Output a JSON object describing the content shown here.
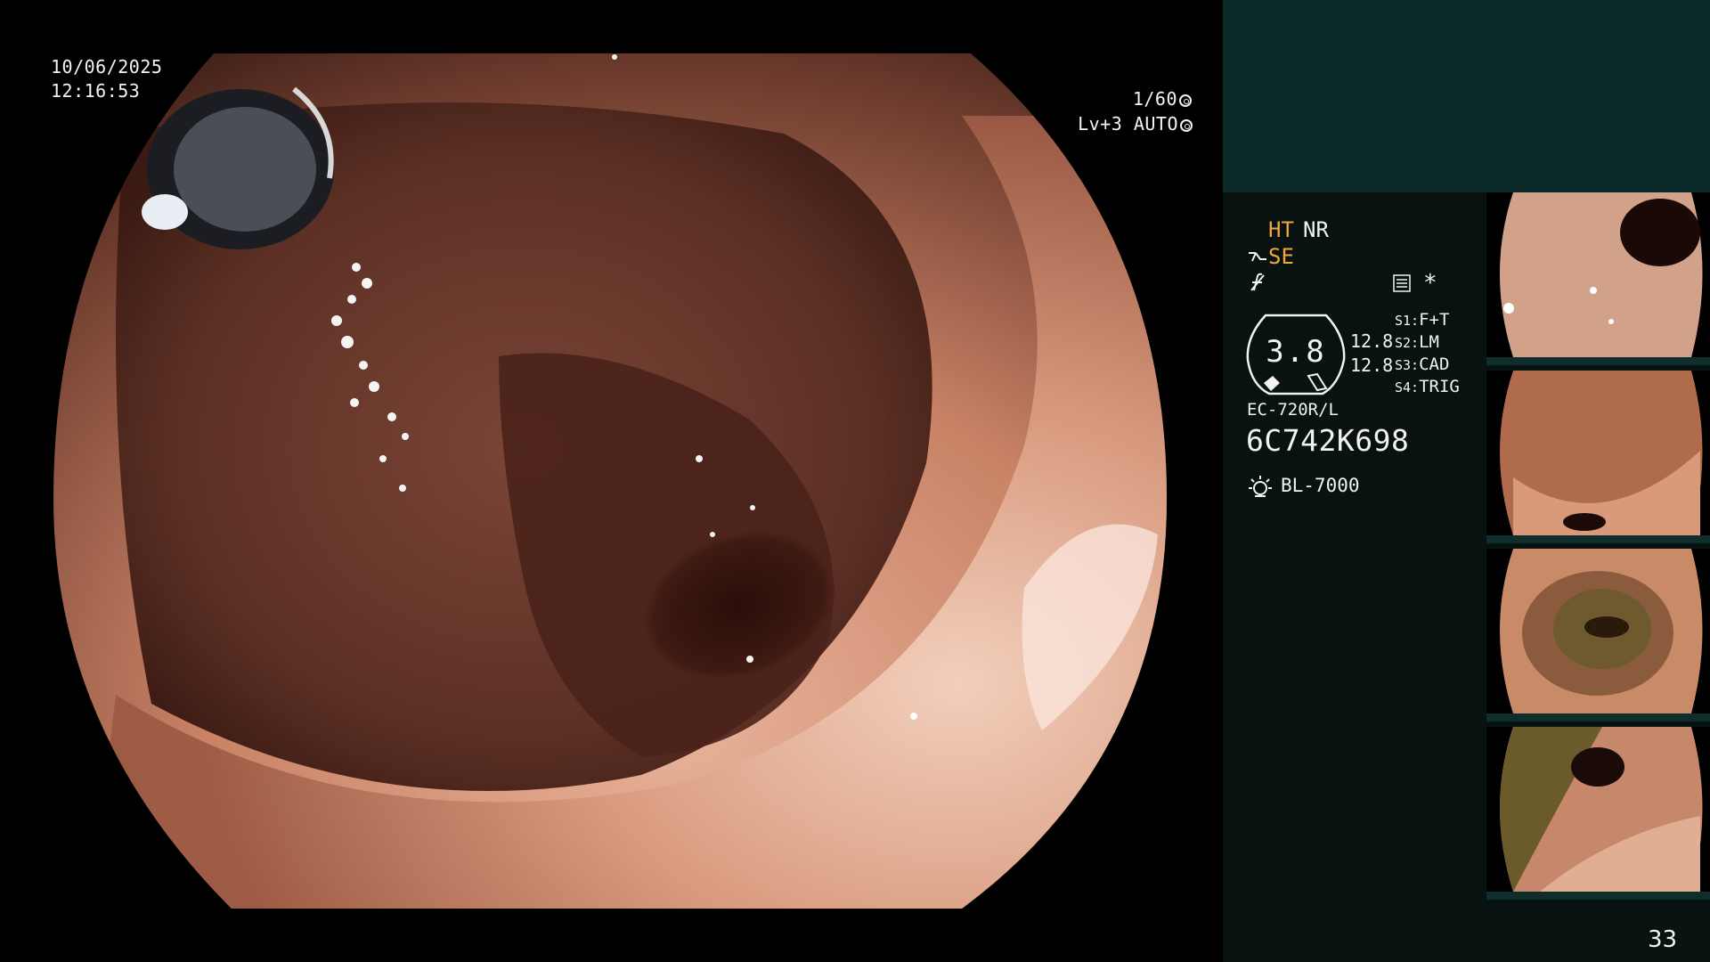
{
  "osd": {
    "date": "10/06/2025",
    "time": "12:16:53",
    "shutter": "1/60",
    "level": "Lv+3 AUTO"
  },
  "panel": {
    "mode_ht": "HT",
    "mode_nr": "NR",
    "mode_se": "SE",
    "star": "*",
    "gauge_value": "3.8",
    "gauge_num_1": "12.8",
    "gauge_num_2": "12.8",
    "switches": [
      {
        "key": "S1:",
        "value": "F+T"
      },
      {
        "key": "S2:",
        "value": "LM"
      },
      {
        "key": "S3:",
        "value": "CAD"
      },
      {
        "key": "S4:",
        "value": "TRIG"
      }
    ],
    "scope_model": "EC-720R/L",
    "scope_serial": "6C742K698",
    "light_source": "BL-7000",
    "accent_color": "#f2a53a"
  },
  "thumbnails": [
    {
      "label": "thumbnail-1"
    },
    {
      "label": "thumbnail-2"
    },
    {
      "label": "thumbnail-3"
    },
    {
      "label": "thumbnail-4"
    }
  ],
  "page_number": "33"
}
